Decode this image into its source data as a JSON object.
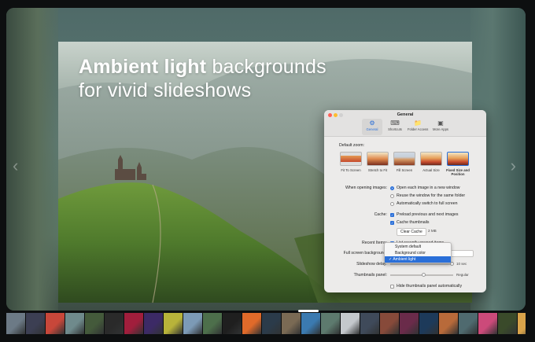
{
  "headline": {
    "bold": "Ambient light",
    "rest": " backgrounds",
    "line2": "for vivid slideshows"
  },
  "window": {
    "title": "General",
    "tabs": [
      {
        "label": "General",
        "icon": "gear-icon",
        "active": true
      },
      {
        "label": "Shortcuts",
        "icon": "keyboard-icon",
        "active": false
      },
      {
        "label": "Folder Access",
        "icon": "folder-icon",
        "active": false
      },
      {
        "label": "More Apps",
        "icon": "apps-icon",
        "active": false
      }
    ]
  },
  "prefs": {
    "default_zoom_label": "Default zoom:",
    "zoom_options": [
      {
        "label": "Fit To Screen",
        "selected": false
      },
      {
        "label": "Stretch to Fit",
        "selected": false
      },
      {
        "label": "Fill Screen",
        "selected": false
      },
      {
        "label": "Actual Size",
        "selected": false
      },
      {
        "label": "Fixed Size and Position",
        "selected": true
      }
    ],
    "opening_label": "When opening images:",
    "opening_options": [
      {
        "label": "Open each image in a new window",
        "selected": true
      },
      {
        "label": "Reuse the window for the same folder",
        "selected": false
      },
      {
        "label": "Automatically switch to full screen",
        "selected": false
      }
    ],
    "cache_label": "Cache:",
    "cache_options": [
      {
        "label": "Preload previous and next images",
        "checked": true
      },
      {
        "label": "Cache thumbnails",
        "checked": true
      }
    ],
    "clear_cache_button": "Clear Cache",
    "cache_size": "2 MB",
    "recent_items_label": "Recent Items:",
    "recent_items_option": "List recently opened items",
    "fullscreen_bg_label": "Full screen background:",
    "bg_options": [
      "System default",
      "Background color",
      "Ambient light"
    ],
    "bg_selected_index": 2,
    "slideshow_delay_label": "Slideshow delay:",
    "slideshow_delay_value": "10 sec",
    "thumbnails_panel_label": "Thumbnails panel:",
    "thumbnails_panel_value": "Regular",
    "hide_thumbnails_option": "Hide thumbnails panel automatically",
    "checkmark": "✓"
  },
  "filmstrip": {
    "colors": [
      "#6c7a86",
      "#3c3f53",
      "#c8473a",
      "#6f8a8c",
      "#445a3b",
      "#2a2a2a",
      "#a11e3c",
      "#3c2a66",
      "#b8b33a",
      "#7c9ab6",
      "#4d6f4b",
      "#1f1f1f",
      "#e06a2a",
      "#2b3b4a",
      "#7a6a54",
      "#3b7ab0",
      "#5d7a6e",
      "#c4c8cc",
      "#3f4a5a",
      "#874a3a",
      "#6a2b4a",
      "#1d3a5a",
      "#b86a3a",
      "#4f6a6f",
      "#cc4a7a",
      "#3a4a2a",
      "#d9a34a",
      "#2a4a6a",
      "#8a8a8a",
      "#5a3a2a",
      "#6a8aa8",
      "#2a2a3a"
    ]
  }
}
